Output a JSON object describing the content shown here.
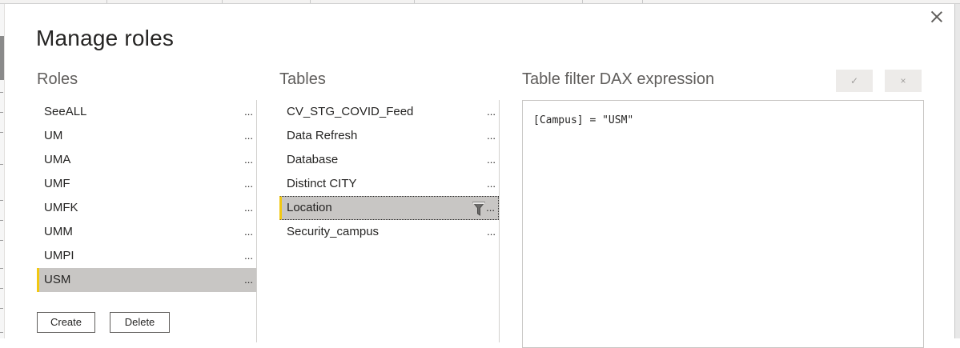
{
  "dialog": {
    "title": "Manage roles",
    "close_icon": "close-icon"
  },
  "roles": {
    "heading": "Roles",
    "items": [
      {
        "label": "SeeALL",
        "more": "..."
      },
      {
        "label": "UM",
        "more": "..."
      },
      {
        "label": "UMA",
        "more": "..."
      },
      {
        "label": "UMF",
        "more": "..."
      },
      {
        "label": "UMFK",
        "more": "..."
      },
      {
        "label": "UMM",
        "more": "..."
      },
      {
        "label": "UMPI",
        "more": "..."
      },
      {
        "label": "USM",
        "more": "...",
        "selected": true
      }
    ],
    "create_label": "Create",
    "delete_label": "Delete"
  },
  "tables": {
    "heading": "Tables",
    "items": [
      {
        "label": "CV_STG_COVID_Feed",
        "more": "..."
      },
      {
        "label": "Data Refresh",
        "more": "..."
      },
      {
        "label": "Database",
        "more": "..."
      },
      {
        "label": "Distinct CITY",
        "more": "..."
      },
      {
        "label": "Location",
        "more": "...",
        "selected": true,
        "filter_icon": "filter-icon"
      },
      {
        "label": "Security_campus",
        "more": "..."
      }
    ]
  },
  "dax": {
    "heading": "Table filter DAX expression",
    "accept_label": "✓",
    "cancel_label": "×",
    "expression": "[Campus] = \"USM\""
  },
  "colors": {
    "selected_bg": "#c8c6c4",
    "accent": "#f2c811",
    "heading": "#605e5c"
  }
}
